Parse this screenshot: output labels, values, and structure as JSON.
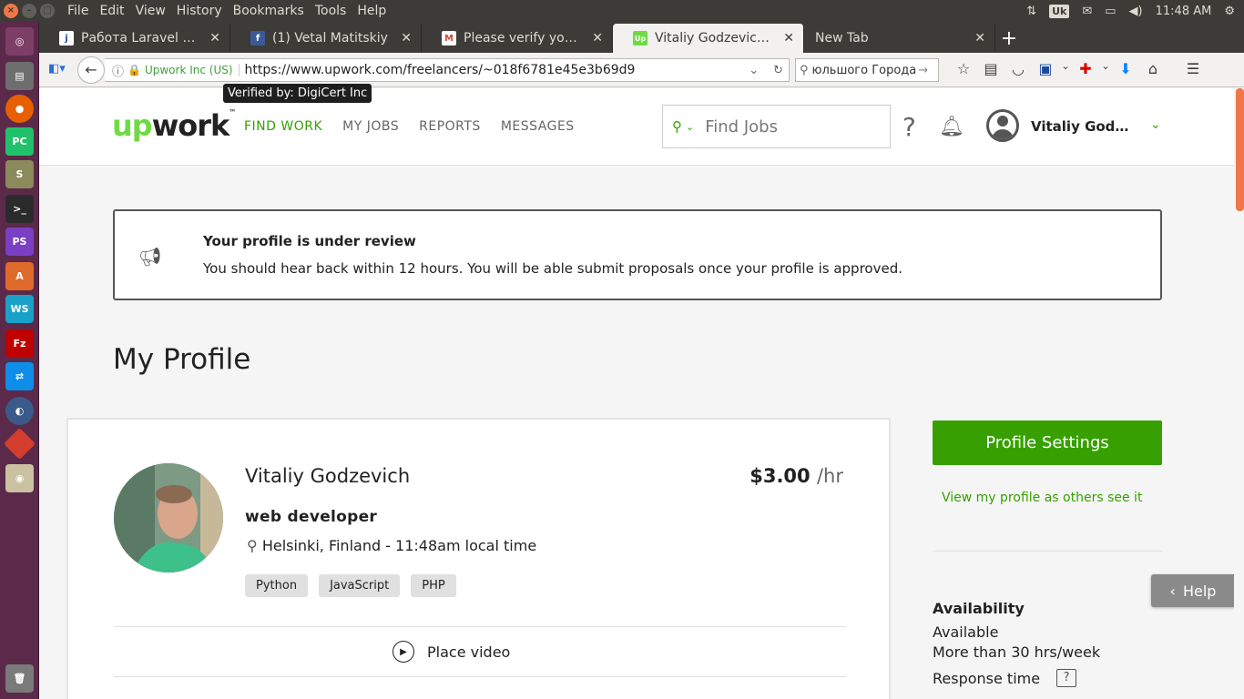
{
  "system": {
    "menus": [
      "File",
      "Edit",
      "View",
      "History",
      "Bookmarks",
      "Tools",
      "Help"
    ],
    "keyboard_layout": "Uk",
    "clock": "11:48 AM"
  },
  "tabs": [
    {
      "label": "Работа Laravel Кие…",
      "favicon": "j",
      "favicon_color": "#1a4aa0"
    },
    {
      "label": "(1) Vetal Matitskiy",
      "favicon": "f",
      "favicon_color": "#3b5998"
    },
    {
      "label": "Please verify your e…",
      "favicon": "M",
      "favicon_color": "#d44638"
    },
    {
      "label": "Vitaliy Godzevich - …",
      "favicon": "Up",
      "favicon_color": "#6fda44",
      "active": true
    },
    {
      "label": "New Tab",
      "favicon": "",
      "favicon_color": ""
    }
  ],
  "navbar": {
    "identity": "Upwork Inc (US)",
    "url": "https://www.upwork.com/freelancers/~018f6781e45e3b69d9",
    "search_value": "юльшого Города",
    "tooltip": "Verified by: DigiCert Inc"
  },
  "header": {
    "logo_up": "up",
    "logo_work": "work",
    "nav": [
      "FIND WORK",
      "MY JOBS",
      "REPORTS",
      "MESSAGES"
    ],
    "search_placeholder": "Find Jobs",
    "help_symbol": "?",
    "username": "Vitaliy Godze…"
  },
  "notice": {
    "title": "Your profile is under review",
    "text": "You should hear back within 12 hours. You will be able submit proposals once your profile is approved."
  },
  "page_title": "My Profile",
  "profile": {
    "name": "Vitaliy Godzevich",
    "rate": "$3.00",
    "rate_unit": "/hr",
    "title": "web developer",
    "location": "Helsinki, Finland - 11:48am local time",
    "skills": [
      "Python",
      "JavaScript",
      "PHP"
    ],
    "video_label": "Place video"
  },
  "sidebar": {
    "settings_button": "Profile Settings",
    "view_link": "View my profile as others see it",
    "availability_heading": "Availability",
    "availability_value": "Available",
    "availability_hours": "More than 30 hrs/week",
    "response_time_label": "Response time"
  },
  "help_tab": "Help",
  "colors": {
    "brand_green": "#37a000",
    "logo_green": "#6fda44",
    "ubuntu_orange": "#f07746"
  }
}
